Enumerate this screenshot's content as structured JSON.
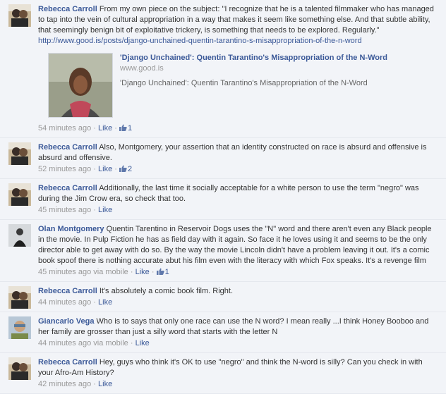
{
  "comments": [
    {
      "author": "Rebecca Carroll",
      "text": "From my own piece on the subject: \"I recognize that he is a talented filmmaker who has managed to tap into the vein of cultural appropriation in a way that makes it seem like something else. And that subtle ability, that seemingly benign bit of exploitative trickery, is something that needs to be explored. Regularly.\"",
      "link": "http://www.good.is/posts/django-unchained-quentin-tarantino-s-misappropriation-of-the-n-word",
      "share": {
        "title": "'Django Unchained': Quentin Tarantino's Misappropriation of the N-Word",
        "domain": "www.good.is",
        "description": "'Django Unchained': Quentin Tarantino's Misappropriation of the N-Word"
      },
      "time": "54 minutes ago",
      "like_label": "Like",
      "likes": "1"
    },
    {
      "author": "Rebecca Carroll",
      "text": "Also, Montgomery, your assertion that an identity constructed on race is absurd and offensive is absurd and offensive.",
      "time": "52 minutes ago",
      "like_label": "Like",
      "likes": "2"
    },
    {
      "author": "Rebecca Carroll",
      "text": "Additionally, the last time it socially acceptable for a white person to use the term \"negro\" was during the Jim Crow era, so check that too.",
      "time": "45 minutes ago",
      "like_label": "Like"
    },
    {
      "author": "Olan Montgomery",
      "text": "Quentin Tarentino in Reservoir Dogs uses the \"N\" word and there aren't even any Black people in the movie. In Pulp Fiction he has as field day with it again. So face it he loves using it and seems to be the only director able to get away with do so. By the way the movie Lincoln didn't have a problem leaving it out. It's a comic book spoof there is nothing accurate abut his film even with the literacy with which Fox speaks. It's a revenge film",
      "time": "45 minutes ago via mobile",
      "like_label": "Like",
      "likes": "1"
    },
    {
      "author": "Rebecca Carroll",
      "text": "It's absolutely a comic book film. Right.",
      "time": "44 minutes ago",
      "like_label": "Like"
    },
    {
      "author": "Giancarlo Vega",
      "text": "Who is to says that only one race can use the N word? I mean really ...I think Honey Booboo and her family are grosser than just a silly word that starts with the letter N",
      "time": "44 minutes ago via mobile",
      "like_label": "Like"
    },
    {
      "author": "Rebecca Carroll",
      "text": "Hey, guys who think it's OK to use \"negro\" and think the N-word is silly? Can you check in with your Afro-Am History?",
      "time": "42 minutes ago",
      "like_label": "Like"
    }
  ],
  "avatar_icons": [
    "profile-photo-icon",
    "profile-photo-icon",
    "profile-photo-icon",
    "profile-photo-icon",
    "profile-photo-icon",
    "profile-photo-icon",
    "profile-photo-icon"
  ],
  "like_icon": "thumbs-up-icon",
  "meta_separator": "·",
  "colors": {
    "link": "#3b5998",
    "comment_bg": "#f2f4f8",
    "border": "#e5e8ee",
    "meta": "#999999"
  }
}
